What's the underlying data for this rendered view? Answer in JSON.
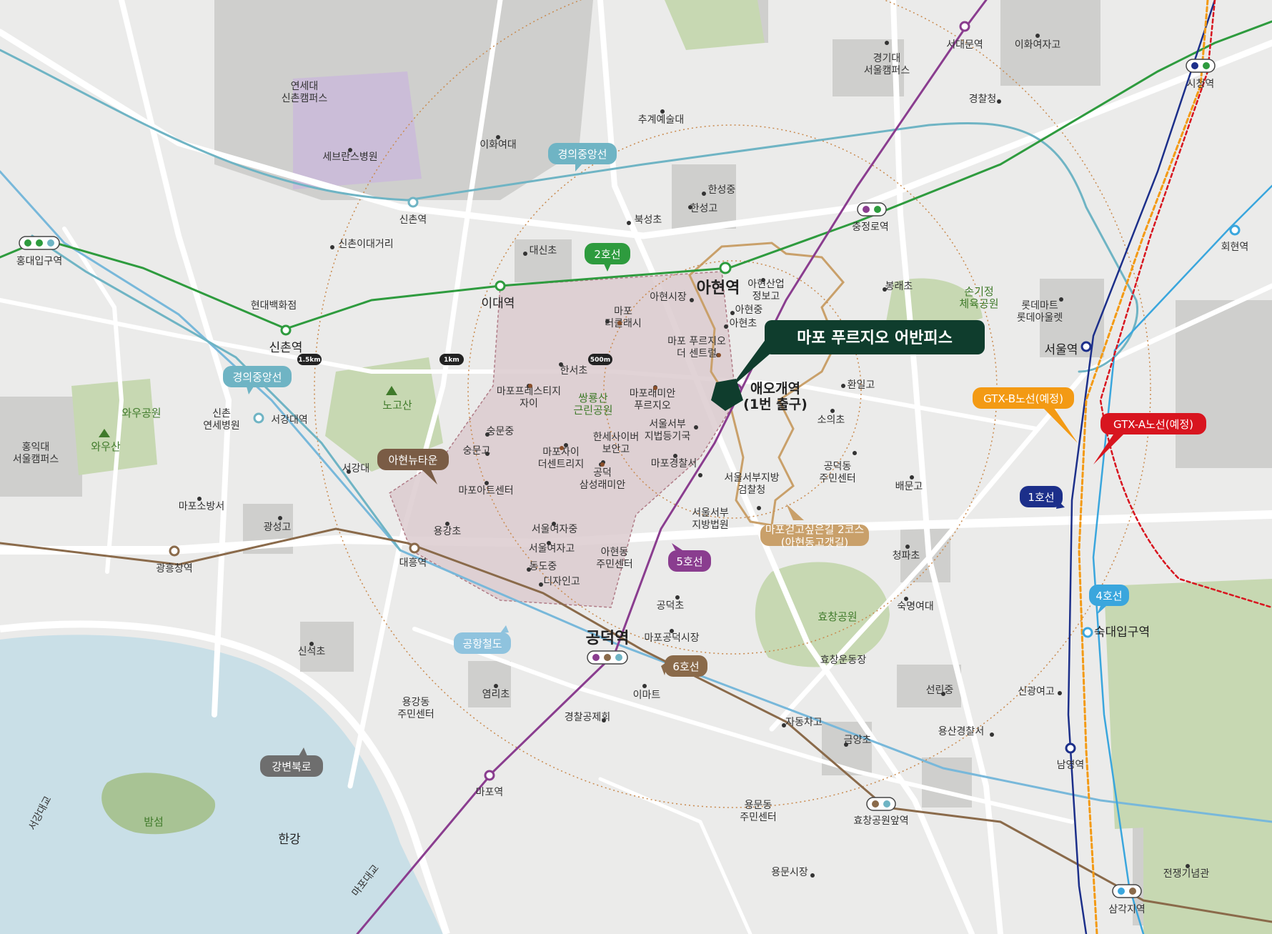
{
  "colors": {
    "line2": "#2e9b3e",
    "gyeongui": "#6fb4c4",
    "line5": "#8a3d8f",
    "line6": "#8a6a4a",
    "line1": "#1c2f8a",
    "line4": "#3aa6dd",
    "airport": "#78b8da",
    "gtx_a": "#d8151f",
    "gtx_b": "#f39a14",
    "newtown": "#7a5c45",
    "highlight": "#0f3d2d"
  },
  "highlight": {
    "title": "마포 푸르지오 어반피스"
  },
  "rings": {
    "r500": "500m",
    "r1km": "1km",
    "r15km": "1.5km"
  },
  "line_tags": {
    "line2": "2호선",
    "line5": "5호선",
    "line6": "6호선",
    "line1": "1호선",
    "line4": "4호선",
    "gyeongui_top": "경의중앙선",
    "gyeongui_left": "경의중앙선",
    "airport": "공항철도",
    "gtx_b": "GTX-B노선(예정)",
    "gtx_a": "GTX-A노선(예정)",
    "newtown": "아현뉴타운",
    "walk_course": [
      "마포걷고싶은길 2코스",
      "(아현동고갯길)"
    ],
    "gangbyeon": "강변북로"
  },
  "stations": {
    "ahyeon": "아현역",
    "aeogae": [
      "애오개역",
      "(1번 출구)"
    ],
    "gongdeok": "공덕역",
    "idae": "이대역",
    "sinchon_line2": "신촌역",
    "sinchon_gj": "신촌역",
    "hongdae": "홍대입구역",
    "chungjeongno": "충정로역",
    "seodaemun": "서대문역",
    "cityhall": "시청역",
    "hoehyeon": "회현역",
    "seoul": "서울역",
    "sookmyung": "숙대입구역",
    "namyeong": "남영역",
    "samgakji": "삼각지역",
    "hyochang": "효창공원앞역",
    "mapo": "마포역",
    "daeheung": "대흥역",
    "gwangheungchang": "광흥창역",
    "seogang": "서강대역"
  },
  "places": {
    "yonsei": [
      "연세대",
      "신촌캠퍼스"
    ],
    "severance": "세브란스병원",
    "ewha_univ": "이화여대",
    "chugye": "추계예술대",
    "kyonggi": [
      "경기대",
      "서울캠퍼스"
    ],
    "ewha_hs": "이화여자고",
    "police": "경찰청",
    "hansung_ms": "한성중",
    "hansung_hs": "한성고",
    "bukseong": "북성초",
    "sinchon_ihwa": "신촌이대거리",
    "daesin": "대신초",
    "hyundai_dept": "현대백화점",
    "ahyeon_market": "아현시장",
    "ahyeon_sanup": [
      "아현산업",
      "정보고"
    ],
    "ahyeon_ms": "아현중",
    "ahyeon_es": "아현초",
    "mapo_declassy": [
      "마포",
      "더클래시"
    ],
    "mapo_prugio_central": [
      "마포 푸르지오",
      "더 센트럴"
    ],
    "bongrae": "봉래초",
    "songijeong": [
      "손기정",
      "체육공원"
    ],
    "lotte_mart": [
      "롯데마트",
      "롯데아울렛"
    ],
    "hanseo_es": "한서초",
    "mapo_prestige": [
      "마포프레스티지",
      "자이"
    ],
    "ssangnyongsan": [
      "쌍룡산",
      "근린공원"
    ],
    "mapo_raemian": [
      "마포래미안",
      "푸르지오"
    ],
    "hwanil": "환일고",
    "soui": "소의초",
    "wau_park": "와우공원",
    "wausan": "와우산",
    "hongik": [
      "홍익대",
      "서울캠퍼스"
    ],
    "sinchon_severance": [
      "신촌",
      "연세병원"
    ],
    "nogosan": "노고산",
    "sungmun": "숭문중",
    "sungmun_hs": "숭문고",
    "seogang_univ": "서강대",
    "mapo_xi": [
      "마포자이",
      "더센트리지"
    ],
    "hanse_cyber": [
      "한세사이버",
      "보안고"
    ],
    "seoul_west_reg": [
      "서울서부",
      "지법등기국"
    ],
    "gongdeok_samsung": [
      "공덕",
      "삼성래미안"
    ],
    "mapo_police": "마포경찰서",
    "seobu_prosecutor": [
      "서울서부지방",
      "검찰청"
    ],
    "gongdeok_center": [
      "공덕동",
      "주민센터"
    ],
    "baemun": "배문고",
    "mapo_art": "마포아트센터",
    "mapo_fire": "마포소방서",
    "gwangseong": "광성고",
    "yonggang_es": "용강초",
    "seoul_girls_ms": "서울여자중",
    "seoul_girls_hs": "서울여자고",
    "dongdo_ms": "동도중",
    "design_hs": "디자인고",
    "ahyeon_center": [
      "아현동",
      "주민센터"
    ],
    "seobu_court": [
      "서울서부",
      "지방법원"
    ],
    "cheongpa": "청파초",
    "hyochang_park": "효창공원",
    "sookmyung_univ": "숙명여대",
    "hyochang_stadium": "효창운동장",
    "gongdeok_es": "공덕초",
    "gongdeok_market": "마포공덕시장",
    "sinseok": "신석초",
    "yeomni": "염리초",
    "emart": "이마트",
    "police_mutual": "경찰공제회",
    "yonggang_center": [
      "용강동",
      "주민센터"
    ],
    "jadong_hs": "자동차고",
    "geumyang": "금양초",
    "seollin": "선린중",
    "singwang": "신광여고",
    "yongsan_police": "용산경찰서",
    "yongmun_center": [
      "용문동",
      "주민센터"
    ],
    "yongmun_market": "용문시장",
    "war_memorial": "전쟁기념관",
    "bamseom": "밤섬",
    "hangang": "한강",
    "seogang_bridge": "서강대교",
    "mapo_bridge": "마포대교"
  }
}
